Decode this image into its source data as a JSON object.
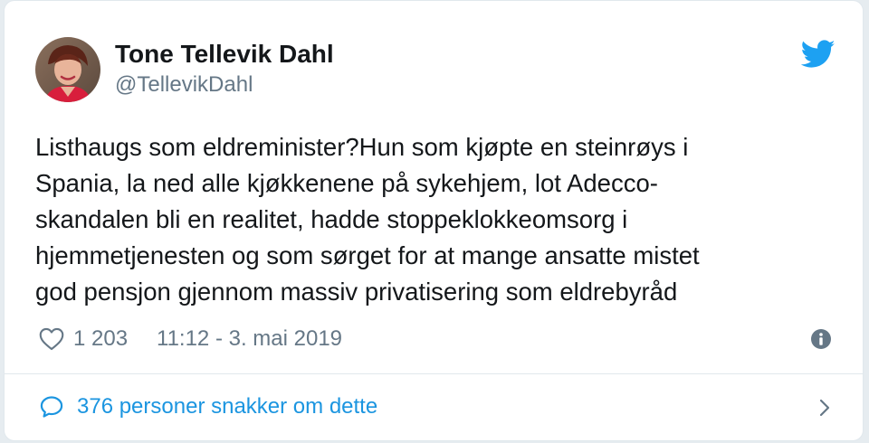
{
  "author": {
    "name": "Tone Tellevik Dahl",
    "handle": "@TellevikDahl"
  },
  "tweet": {
    "text": "Listhaugs som eldreminister?Hun som kjøpte en steinrøys i\nSpania, la ned alle kjøkkenene på sykehjem, lot Adecco-\nskandalen bli en realitet, hadde stoppeklokkeomsorg i\nhjemmetjenesten og som sørget for at mange ansatte mistet\ngod pensjon gjennom massiv privatisering som eldrebyråd",
    "likes": "1 203",
    "timestamp": "11:12 - 3. mai 2019"
  },
  "footer": {
    "conversation_label": "376 personer snakker om dette"
  },
  "icons": {
    "brand": "twitter-bird-icon",
    "like": "heart-icon",
    "info": "info-icon",
    "conversation": "speech-bubble-icon",
    "chevron": "chevron-right-icon"
  },
  "colors": {
    "brand": "#1da1f2",
    "link": "#1b95e0",
    "secondary_text": "#657786",
    "text": "#14171a",
    "border": "#e1e8ed"
  }
}
